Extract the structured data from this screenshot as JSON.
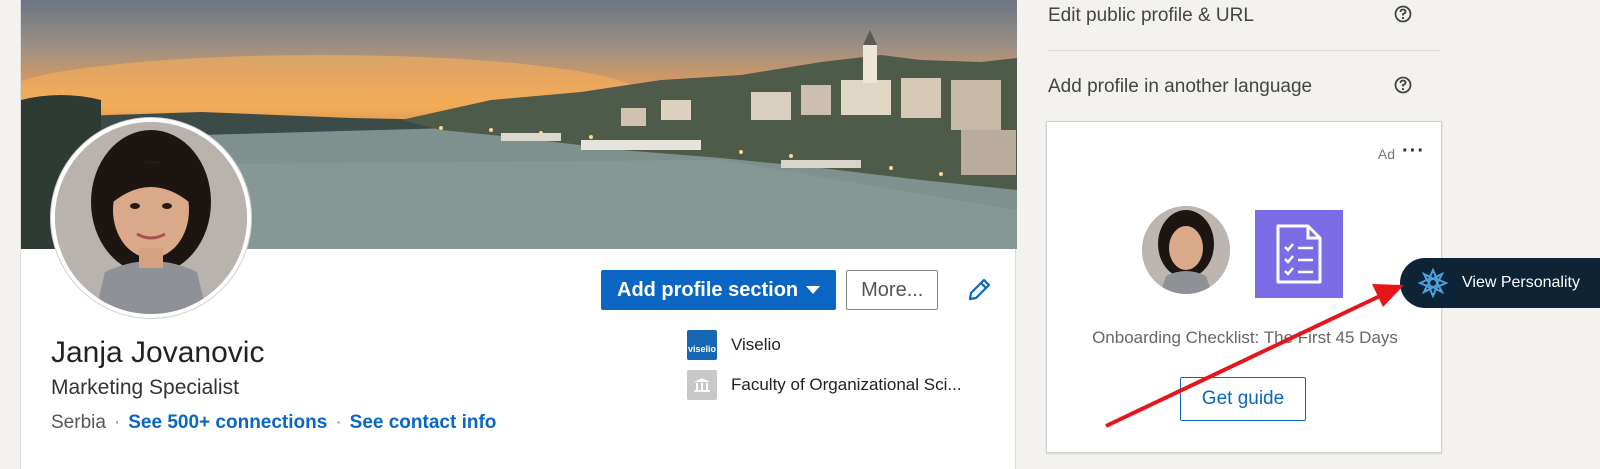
{
  "profile": {
    "name": "Janja Jovanovic",
    "headline": "Marketing Specialist",
    "location": "Serbia",
    "connections_link": "See 500+ connections",
    "contact_link": "See contact info",
    "separator": "·",
    "actions": {
      "add_section": "Add profile section",
      "more": "More..."
    },
    "experience": [
      {
        "label": "Viselio",
        "logo_text": "viselio"
      },
      {
        "label": "Faculty of Organizational Sci..."
      }
    ]
  },
  "right_rail": {
    "edit_public_profile": "Edit public profile & URL",
    "add_language_profile": "Add profile in another language"
  },
  "ad": {
    "label": "Ad",
    "more": "···",
    "title": "Onboarding Checklist: The First 45 Days",
    "cta": "Get guide"
  },
  "overlay": {
    "view_personality": "View Personality"
  },
  "colors": {
    "accent": "#0a66c2",
    "checklist_tile": "#7b6ce6",
    "overlay_bg": "#0d2336",
    "annotation_arrow": "#e8141b"
  }
}
